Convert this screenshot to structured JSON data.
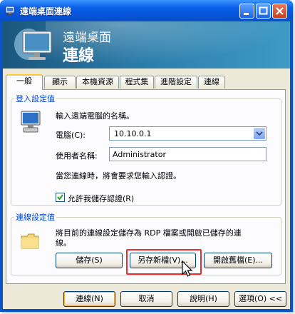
{
  "window": {
    "title": "遠端桌面連線"
  },
  "banner": {
    "line1": "遠端桌面",
    "line2": "連線"
  },
  "tabs": [
    "一般",
    "顯示",
    "本機資源",
    "程式集",
    "進階設定",
    "連線"
  ],
  "logon": {
    "legend": "登入設定值",
    "instruction": "輸入遠端電腦的名稱。",
    "computer_label": "電腦(C):",
    "computer_value": "10.10.0.1",
    "username_label": "使用者名稱:",
    "username_value": "Administrator",
    "credentials_note": "當您連線時，將會要求您輸入認證。",
    "save_credentials_label": "允許我儲存認證(R)"
  },
  "connection_settings": {
    "legend": "連線設定值",
    "description_line1": "將目前的連線設定儲存為 RDP 檔案或開啟已儲存的連",
    "description_line2": "線。",
    "save_label": "儲存(S)",
    "save_as_label": "另存新檔(V)...",
    "open_label": "開啟舊檔(E)..."
  },
  "footer": {
    "connect_label": "連線(N)",
    "cancel_label": "取消",
    "help_label": "說明(H)",
    "options_label": "選項(O) <<"
  }
}
